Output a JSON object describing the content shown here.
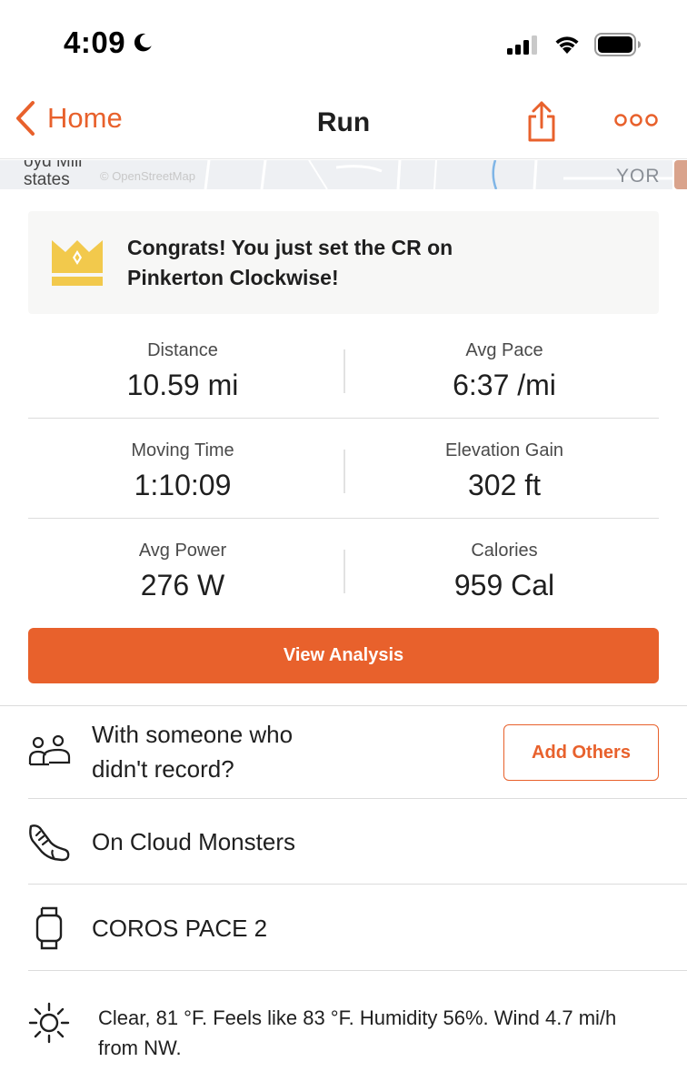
{
  "status_bar": {
    "time": "4:09"
  },
  "nav": {
    "back_label": "Home",
    "title": "Run"
  },
  "map": {
    "label_line1": "oyd Mill",
    "label_line2": "states",
    "credit": "© OpenStreetMap",
    "corner_text": "YOR"
  },
  "congrats": {
    "line1": "Congrats! You just set the CR on",
    "line2": "Pinkerton Clockwise!"
  },
  "stats": [
    {
      "left": {
        "label": "Distance",
        "value": "10.59 mi"
      },
      "right": {
        "label": "Avg Pace",
        "value": "6:37 /mi"
      }
    },
    {
      "left": {
        "label": "Moving Time",
        "value": "1:10:09"
      },
      "right": {
        "label": "Elevation Gain",
        "value": "302 ft"
      }
    },
    {
      "left": {
        "label": "Avg Power",
        "value": "276 W"
      },
      "right": {
        "label": "Calories",
        "value": "959 Cal"
      }
    }
  ],
  "view_analysis_label": "View Analysis",
  "with_others": {
    "line1": "With someone who",
    "line2": "didn't record?",
    "button_label": "Add Others"
  },
  "gear": {
    "shoes": "On Cloud Monsters",
    "device": "COROS PACE 2"
  },
  "weather": {
    "text": "Clear, 81 °F. Feels like 83 °F. Humidity 56%. Wind 4.7 mi/h from NW."
  },
  "colors": {
    "accent": "#e8612c",
    "crown": "#f2c94c"
  }
}
